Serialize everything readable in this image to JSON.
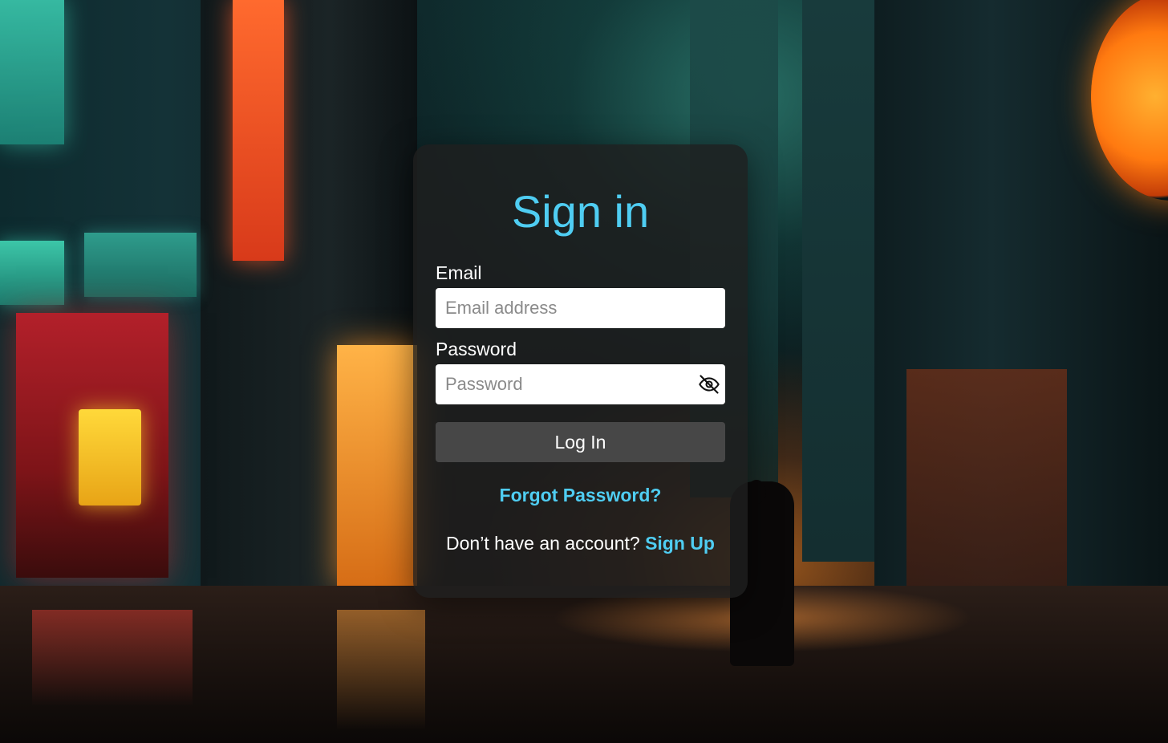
{
  "card": {
    "title": "Sign in",
    "email": {
      "label": "Email",
      "placeholder": "Email address",
      "value": ""
    },
    "password": {
      "label": "Password",
      "placeholder": "Password",
      "value": "",
      "toggle_icon": "eye-off-icon"
    },
    "login_button": "Log In",
    "forgot_link": "Forgot Password?",
    "signup_prompt": "Don’t have an account?",
    "signup_link": "Sign Up"
  },
  "colors": {
    "accent": "#4fcdf2",
    "card_background": "#1e1e1e",
    "button_background": "#474747",
    "text": "#ffffff"
  }
}
